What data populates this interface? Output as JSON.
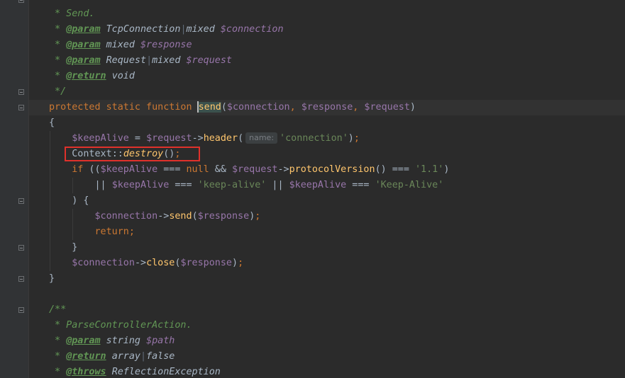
{
  "editor": {
    "lines": [
      {
        "id": "doc1-summary",
        "tokens": [
          [
            "doc-c",
            " * Send."
          ]
        ]
      },
      {
        "id": "doc1-param1",
        "tokens": [
          [
            "doc-c",
            " * "
          ],
          [
            "doc-tag",
            "@param"
          ],
          [
            "doc-c",
            " "
          ],
          [
            "doc-type",
            "TcpConnection"
          ],
          [
            "pipe",
            "|"
          ],
          [
            "doc-type",
            "mixed"
          ],
          [
            "doc-c",
            " "
          ],
          [
            "doc-var",
            "$connection"
          ]
        ]
      },
      {
        "id": "doc1-param2",
        "tokens": [
          [
            "doc-c",
            " * "
          ],
          [
            "doc-tag",
            "@param"
          ],
          [
            "doc-c",
            " "
          ],
          [
            "doc-type",
            "mixed"
          ],
          [
            "doc-c",
            " "
          ],
          [
            "doc-var",
            "$response"
          ]
        ]
      },
      {
        "id": "doc1-param3",
        "tokens": [
          [
            "doc-c",
            " * "
          ],
          [
            "doc-tag",
            "@param"
          ],
          [
            "doc-c",
            " "
          ],
          [
            "doc-type",
            "Request"
          ],
          [
            "pipe",
            "|"
          ],
          [
            "doc-type",
            "mixed"
          ],
          [
            "doc-c",
            " "
          ],
          [
            "doc-var",
            "$request"
          ]
        ]
      },
      {
        "id": "doc1-return",
        "tokens": [
          [
            "doc-c",
            " * "
          ],
          [
            "doc-tag",
            "@return"
          ],
          [
            "doc-c",
            " "
          ],
          [
            "doc-type",
            "void"
          ]
        ]
      },
      {
        "id": "doc1-close",
        "tokens": [
          [
            "doc-c",
            " */"
          ]
        ]
      },
      {
        "id": "fn-signature",
        "tokens": [
          [
            "kw",
            "protected static function "
          ],
          [
            "caret",
            ""
          ],
          [
            "fn match-bg",
            "send"
          ],
          [
            "pl",
            "("
          ],
          [
            "var",
            "$connection"
          ],
          [
            "kw",
            ", "
          ],
          [
            "var",
            "$response"
          ],
          [
            "kw",
            ", "
          ],
          [
            "var",
            "$request"
          ],
          [
            "pl",
            ")"
          ]
        ]
      },
      {
        "id": "fn-open-brace",
        "tokens": [
          [
            "pl",
            "{"
          ]
        ]
      },
      {
        "id": "keepalive-assign",
        "tokens": [
          [
            "pl",
            "    "
          ],
          [
            "var",
            "$keepAlive"
          ],
          [
            "pl",
            " = "
          ],
          [
            "var",
            "$request"
          ],
          [
            "pl",
            "->"
          ],
          [
            "fn",
            "header"
          ],
          [
            "pl",
            "("
          ],
          [
            "hint",
            "name:"
          ],
          [
            "str",
            "'connection'"
          ],
          [
            "pl",
            ")"
          ],
          [
            "kw",
            ";"
          ]
        ]
      },
      {
        "id": "context-destroy",
        "tokens": [
          [
            "pl",
            "    "
          ],
          [
            "cls",
            "Context"
          ],
          [
            "pl",
            "::"
          ],
          [
            "stat",
            "destroy"
          ],
          [
            "pl",
            "()"
          ],
          [
            "kw",
            ";"
          ]
        ]
      },
      {
        "id": "if-condition",
        "tokens": [
          [
            "pl",
            "    "
          ],
          [
            "kw",
            "if "
          ],
          [
            "pl",
            "(("
          ],
          [
            "var",
            "$keepAlive"
          ],
          [
            "pl",
            " === "
          ],
          [
            "kw",
            "null"
          ],
          [
            "pl",
            " && "
          ],
          [
            "var",
            "$request"
          ],
          [
            "pl",
            "->"
          ],
          [
            "fn",
            "protocolVersion"
          ],
          [
            "pl",
            "() === "
          ],
          [
            "str",
            "'1.1'"
          ],
          [
            "pl",
            ")"
          ]
        ]
      },
      {
        "id": "if-condition-cont",
        "tokens": [
          [
            "pl",
            "        || "
          ],
          [
            "var",
            "$keepAlive"
          ],
          [
            "pl",
            " === "
          ],
          [
            "str",
            "'keep-alive'"
          ],
          [
            "pl",
            " || "
          ],
          [
            "var",
            "$keepAlive"
          ],
          [
            "pl",
            " === "
          ],
          [
            "str",
            "'Keep-Alive'"
          ]
        ]
      },
      {
        "id": "if-open",
        "tokens": [
          [
            "pl",
            "    ) {"
          ]
        ]
      },
      {
        "id": "send-response",
        "tokens": [
          [
            "pl",
            "        "
          ],
          [
            "var",
            "$connection"
          ],
          [
            "pl",
            "->"
          ],
          [
            "fn",
            "send"
          ],
          [
            "pl",
            "("
          ],
          [
            "var",
            "$response"
          ],
          [
            "pl",
            ")"
          ],
          [
            "kw",
            ";"
          ]
        ]
      },
      {
        "id": "return-stmt",
        "tokens": [
          [
            "pl",
            "        "
          ],
          [
            "kw",
            "return;"
          ]
        ]
      },
      {
        "id": "if-close",
        "tokens": [
          [
            "pl",
            "    }"
          ]
        ]
      },
      {
        "id": "close-connection",
        "tokens": [
          [
            "pl",
            "    "
          ],
          [
            "var",
            "$connection"
          ],
          [
            "pl",
            "->"
          ],
          [
            "fn",
            "close"
          ],
          [
            "pl",
            "("
          ],
          [
            "var",
            "$response"
          ],
          [
            "pl",
            ")"
          ],
          [
            "kw",
            ";"
          ]
        ]
      },
      {
        "id": "fn-close-brace",
        "tokens": [
          [
            "pl",
            "}"
          ]
        ]
      },
      {
        "id": "blank",
        "tokens": []
      },
      {
        "id": "doc2-open",
        "tokens": [
          [
            "doc-c",
            "/**"
          ]
        ]
      },
      {
        "id": "doc2-summary",
        "tokens": [
          [
            "doc-c",
            " * ParseControllerAction."
          ]
        ]
      },
      {
        "id": "doc2-param",
        "tokens": [
          [
            "doc-c",
            " * "
          ],
          [
            "doc-tag",
            "@param"
          ],
          [
            "doc-c",
            " "
          ],
          [
            "doc-type",
            "string"
          ],
          [
            "doc-c",
            " "
          ],
          [
            "doc-var",
            "$path"
          ]
        ]
      },
      {
        "id": "doc2-return",
        "tokens": [
          [
            "doc-c",
            " * "
          ],
          [
            "doc-tag",
            "@return"
          ],
          [
            "doc-c",
            " "
          ],
          [
            "doc-type",
            "array"
          ],
          [
            "pipe",
            "|"
          ],
          [
            "doc-type",
            "false"
          ]
        ]
      },
      {
        "id": "doc2-throws",
        "tokens": [
          [
            "doc-c",
            " * "
          ],
          [
            "doc-tag",
            "@throws"
          ],
          [
            "doc-c",
            " "
          ],
          [
            "doc-type",
            "ReflectionException"
          ]
        ]
      }
    ]
  }
}
